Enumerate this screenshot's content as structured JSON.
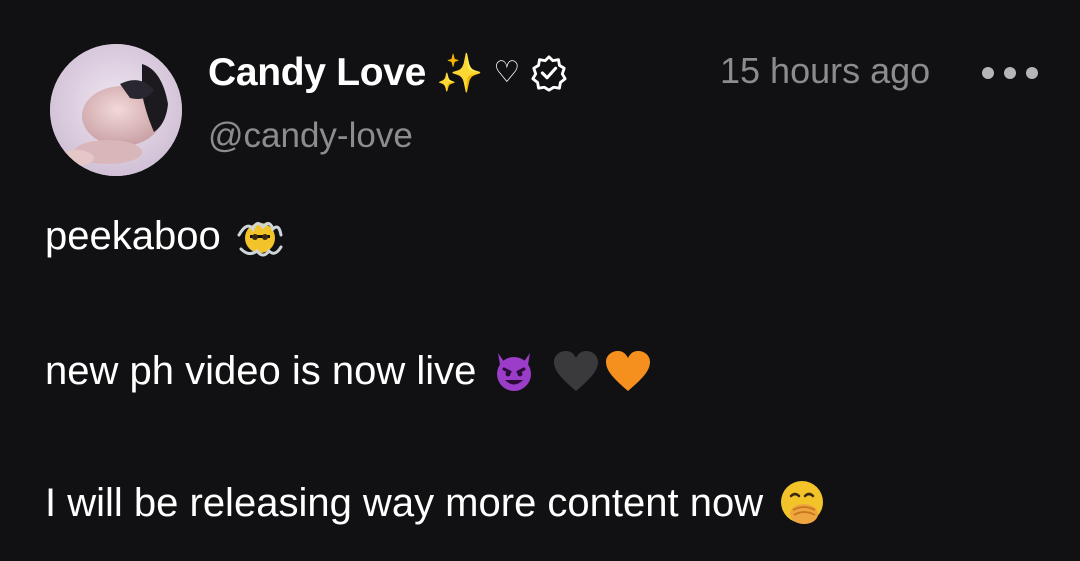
{
  "author": {
    "display_name": "Candy Love",
    "name_emoji": "✨",
    "heart_symbol": "♡",
    "verified_icon": "verified-badge-icon",
    "handle": "@candy-love",
    "avatar_icon": "user-avatar-photo"
  },
  "meta": {
    "timestamp": "15 hours ago",
    "more_icon": "more-options-icon"
  },
  "post": {
    "line1": {
      "text": "peekaboo",
      "emoji": "peeking-face-emoji"
    },
    "line2": {
      "text": "new ph video is now live",
      "emojis": [
        "smiling-devil-emoji",
        "black-heart-emoji",
        "orange-heart-emoji"
      ]
    },
    "line3": {
      "text": "I will be releasing way more content now",
      "emoji": "face-with-hand-over-mouth-emoji"
    }
  },
  "colors": {
    "background": "#111113",
    "primary_text": "#ffffff",
    "secondary_text": "#8c8c90",
    "sparkle": "#f3c21b",
    "devil_purple": "#9b3dc9",
    "orange_heart": "#f5901f",
    "black_heart": "#3a3a3c"
  }
}
